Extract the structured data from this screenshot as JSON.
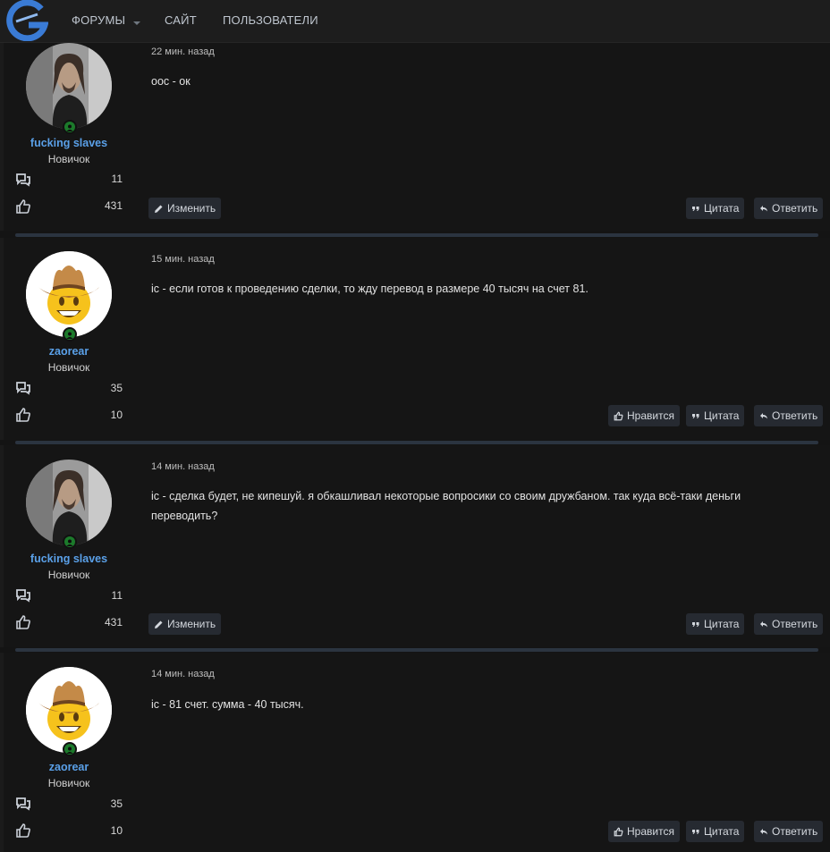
{
  "nav": {
    "items": [
      "ФОРУМЫ",
      "САЙТ",
      "ПОЛЬЗОВАТЕЛИ"
    ]
  },
  "posts": [
    {
      "time": "22 мин. назад",
      "text": "оос - ок",
      "author": "fucking slaves",
      "title": "Новичок",
      "messages": "11",
      "likes": "431",
      "edit_label": "Изменить",
      "quote_label": "Цитата",
      "reply_label": "Ответить"
    },
    {
      "time": "15 мин. назад",
      "text": "ic - если готов к проведению сделки, то жду перевод в размере 40 тысяч на счет 81.",
      "author": "zaorear",
      "title": "Новичок",
      "messages": "35",
      "likes": "10",
      "like_label": "Нравится",
      "quote_label": "Цитата",
      "reply_label": "Ответить"
    },
    {
      "time": "14 мин. назад",
      "text": "ic - сделка будет, не кипешуй. я обкашливал некоторые вопросики со своим дружбаном. так куда всё-таки деньги переводить?",
      "author": "fucking slaves",
      "title": "Новичок",
      "messages": "11",
      "likes": "431",
      "edit_label": "Изменить",
      "quote_label": "Цитата",
      "reply_label": "Ответить"
    },
    {
      "time": "14 мин. назад",
      "text": "ic - 81 счет. сумма - 40 тысяч.",
      "author": "zaorear",
      "title": "Новичок",
      "messages": "35",
      "likes": "10",
      "like_label": "Нравится",
      "quote_label": "Цитата",
      "reply_label": "Ответить"
    }
  ],
  "colors": {
    "username": "#5aa0e8",
    "online": "#1c7a2b",
    "divider": "#2b3440"
  },
  "icons": [
    "forum-logo-icon",
    "chevron-down-icon",
    "user-icon",
    "messages-icon",
    "thumbs-up-icon",
    "pencil-icon",
    "quote-icon",
    "reply-icon"
  ]
}
